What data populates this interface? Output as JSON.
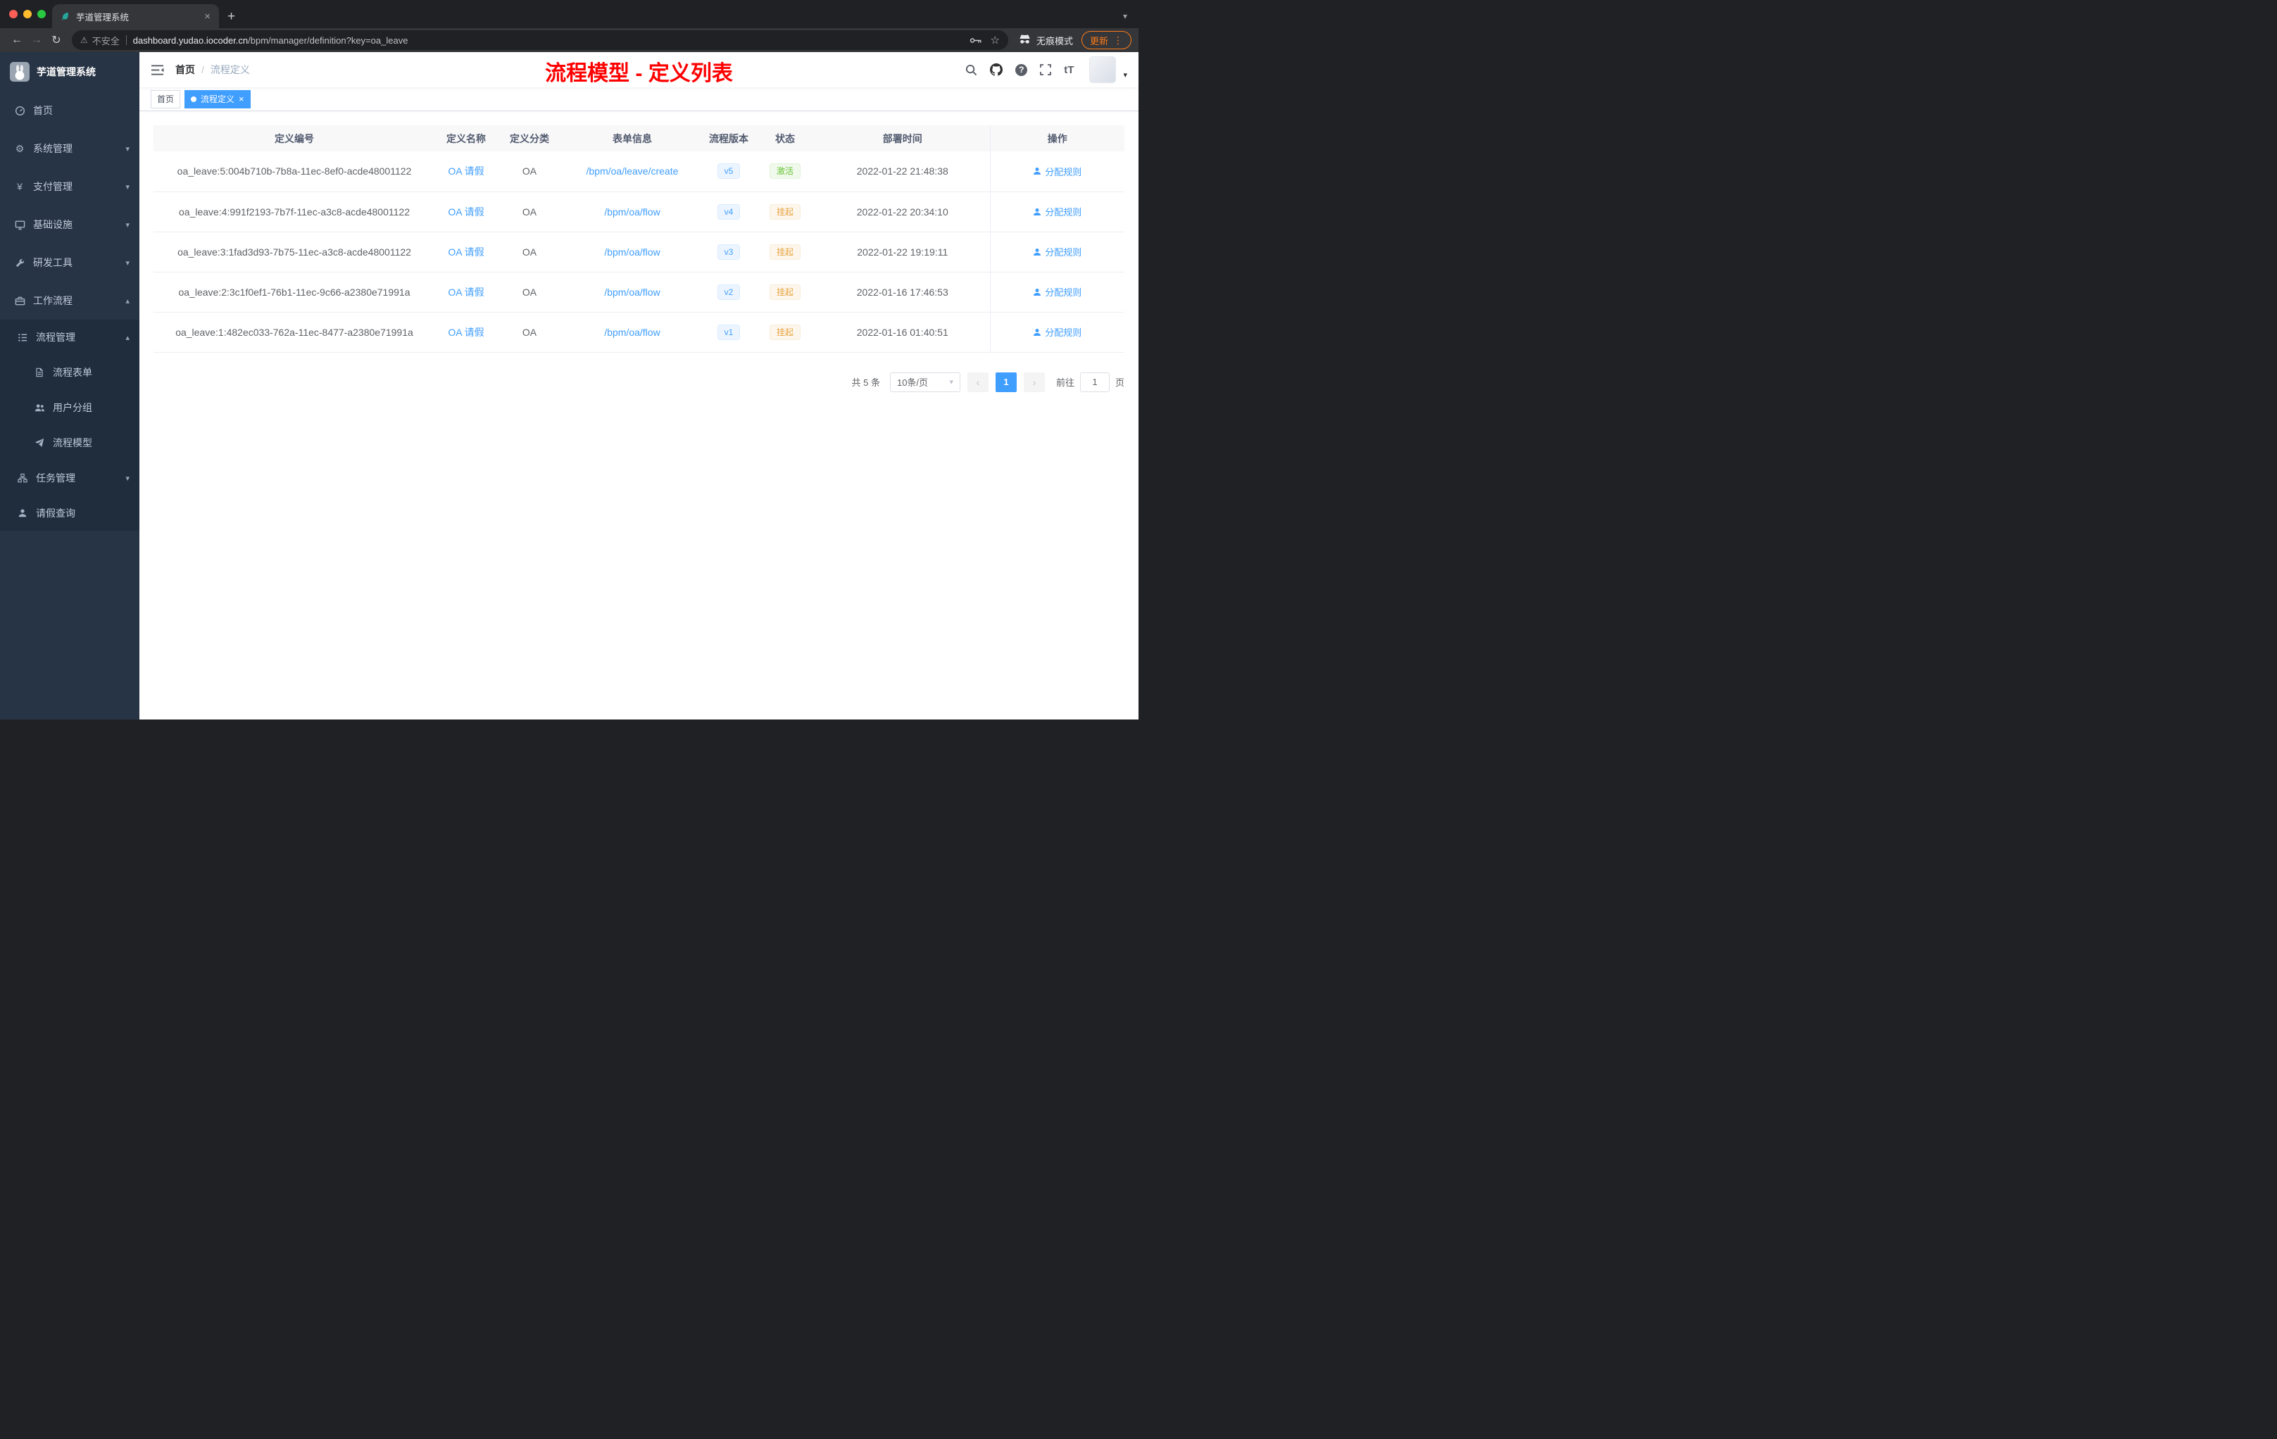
{
  "colors": {
    "accent": "#409eff",
    "success": "#67c23a",
    "warning": "#e6a23c",
    "annotation_red": "#ff0000",
    "sidebar_bg": "#273445",
    "submenu_bg": "#1f2d3d",
    "update_orange": "#fa7b17"
  },
  "icons": {
    "back": "←",
    "forward": "→",
    "reload": "↻",
    "warning": "⚠",
    "star": "☆",
    "kebab": "⋮",
    "plus": "+",
    "close": "×",
    "tab_search_caret": "▾",
    "caret_down": "▾",
    "caret_up": "▴",
    "gear": "⚙",
    "yen": "¥",
    "question": "?",
    "font_size": "tT",
    "breadcrumb_sep": "/",
    "prev": "‹",
    "next": "›",
    "select_caret": "▾",
    "avatar_caret": "▾"
  },
  "browser": {
    "tab_title": "芋道管理系统",
    "security_label": "不安全",
    "url_domain": "dashboard.yudao.iocoder.cn",
    "url_path": "/bpm/manager/definition?key=oa_leave",
    "incognito_label": "无痕模式",
    "update_label": "更新"
  },
  "sidebar": {
    "brand": "芋道管理系统",
    "items": [
      {
        "label": "首页"
      },
      {
        "label": "系统管理"
      },
      {
        "label": "支付管理"
      },
      {
        "label": "基础设施"
      },
      {
        "label": "研发工具"
      },
      {
        "label": "工作流程"
      }
    ],
    "sub": {
      "process_mgmt": "流程管理",
      "children": [
        "流程表单",
        "用户分组",
        "流程模型"
      ],
      "task_mgmt": "任务管理",
      "leave_query": "请假查询"
    }
  },
  "header": {
    "breadcrumb": {
      "home": "首页",
      "current": "流程定义"
    },
    "annotation": "流程模型 - 定义列表"
  },
  "tags": [
    {
      "label": "首页",
      "active": false
    },
    {
      "label": "流程定义",
      "active": true
    }
  ],
  "table": {
    "headers": [
      "定义编号",
      "定义名称",
      "定义分类",
      "表单信息",
      "流程版本",
      "状态",
      "部署时间",
      "操作"
    ],
    "rows": [
      {
        "id": "oa_leave:5:004b710b-7b8a-11ec-8ef0-acde48001122",
        "name": "OA 请假",
        "category": "OA",
        "form": "/bpm/oa/leave/create",
        "version": "v5",
        "status": "激活",
        "status_type": "success",
        "time": "2022-01-22 21:48:38",
        "action": "分配规则"
      },
      {
        "id": "oa_leave:4:991f2193-7b7f-11ec-a3c8-acde48001122",
        "name": "OA 请假",
        "category": "OA",
        "form": "/bpm/oa/flow",
        "version": "v4",
        "status": "挂起",
        "status_type": "warning",
        "time": "2022-01-22 20:34:10",
        "action": "分配规则"
      },
      {
        "id": "oa_leave:3:1fad3d93-7b75-11ec-a3c8-acde48001122",
        "name": "OA 请假",
        "category": "OA",
        "form": "/bpm/oa/flow",
        "version": "v3",
        "status": "挂起",
        "status_type": "warning",
        "time": "2022-01-22 19:19:11",
        "action": "分配规则"
      },
      {
        "id": "oa_leave:2:3c1f0ef1-76b1-11ec-9c66-a2380e71991a",
        "name": "OA 请假",
        "category": "OA",
        "form": "/bpm/oa/flow",
        "version": "v2",
        "status": "挂起",
        "status_type": "warning",
        "time": "2022-01-16 17:46:53",
        "action": "分配规则"
      },
      {
        "id": "oa_leave:1:482ec033-762a-11ec-8477-a2380e71991a",
        "name": "OA 请假",
        "category": "OA",
        "form": "/bpm/oa/flow",
        "version": "v1",
        "status": "挂起",
        "status_type": "warning",
        "time": "2022-01-16 01:40:51",
        "action": "分配规则"
      }
    ]
  },
  "pagination": {
    "total": "共 5 条",
    "page_size": "10条/页",
    "current_page": "1",
    "goto_label": "前往",
    "goto_value": "1",
    "page_unit": "页"
  }
}
